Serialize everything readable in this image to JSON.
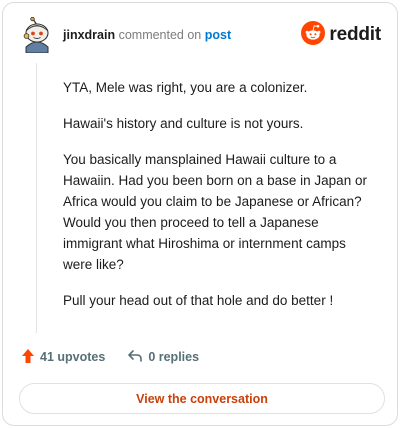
{
  "header": {
    "username": "jinxdrain",
    "action": "commented on",
    "link": "post",
    "brand": "reddit"
  },
  "comment": {
    "paragraphs": [
      "YTA, Mele was right, you are a colonizer.",
      "Hawaii's history and culture is not yours.",
      "You basically mansplained Hawaii culture to a Hawaiin. Had you been born on a base in Japan or Africa would you claim to be Japanese or African? Would you then proceed to tell a Japanese immigrant what Hiroshima or internment camps were like?",
      "Pull your head out of that hole and do better !"
    ]
  },
  "actions": {
    "upvotes_label": "41 upvotes",
    "replies_label": "0 replies"
  },
  "cta": {
    "label": "View the conversation"
  },
  "colors": {
    "reddit_orange": "#ff4500",
    "link_blue": "#0079d3",
    "cta_text": "#c8410b",
    "muted": "#576f76"
  },
  "icons": {
    "avatar": "snoo-avatar-icon",
    "brand": "reddit-logo-icon",
    "upvote": "upvote-arrow-icon",
    "reply": "reply-arrow-icon"
  }
}
